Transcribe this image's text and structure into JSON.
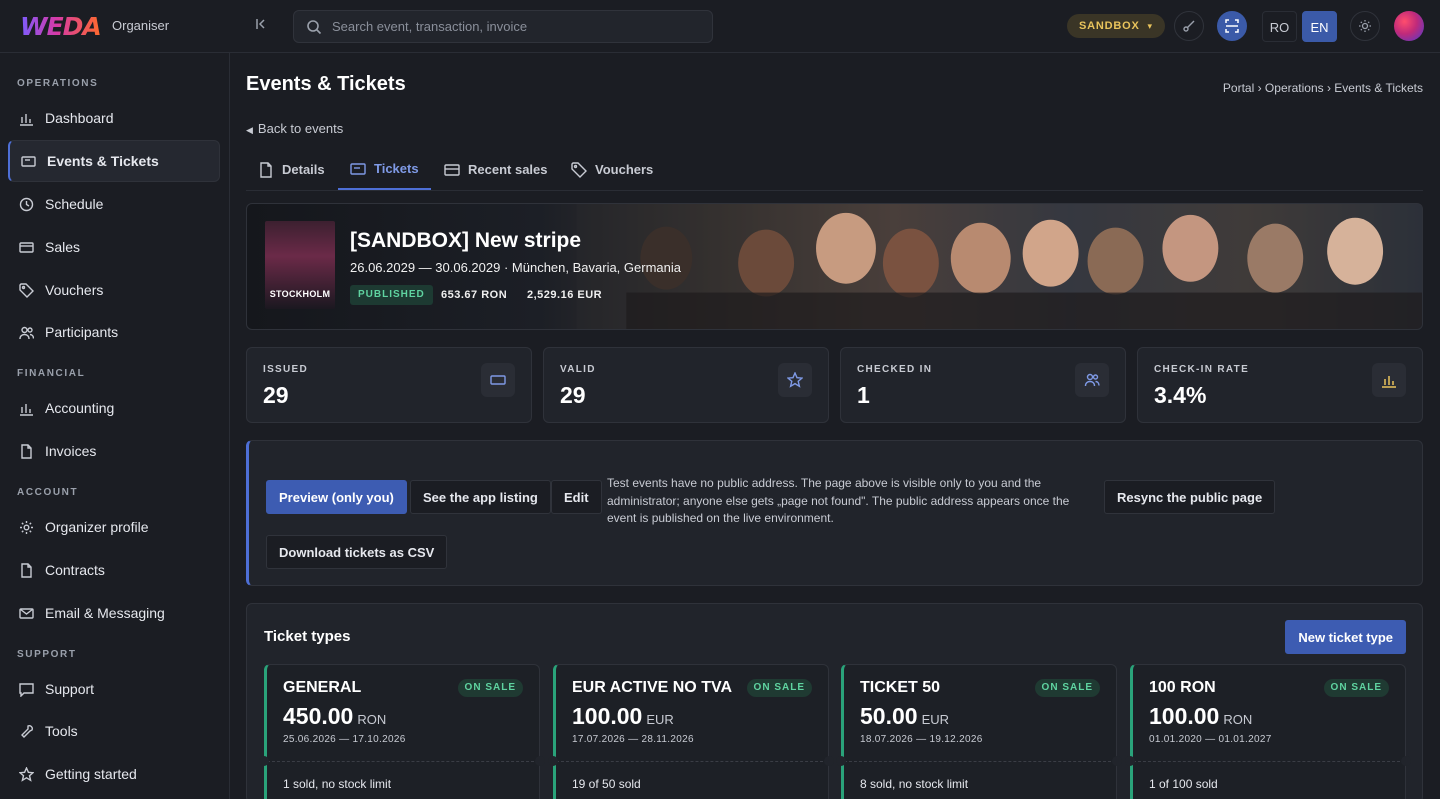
{
  "app": {
    "logo": "WEDA",
    "org_label": "Organiser"
  },
  "search": {
    "placeholder": "Search event, transaction, invoice"
  },
  "topbar": {
    "sandbox_label": "SANDBOX",
    "lang_ro": "RO",
    "lang_en": "EN",
    "active_lang": "EN"
  },
  "sidebar": {
    "sections": [
      {
        "title": "OPERATIONS",
        "items": [
          {
            "label": "Dashboard",
            "icon": "bar-chart-icon"
          },
          {
            "label": "Events & Tickets",
            "icon": "ticket-icon",
            "active": true
          },
          {
            "label": "Schedule",
            "icon": "clock-icon"
          },
          {
            "label": "Sales",
            "icon": "card-icon"
          },
          {
            "label": "Vouchers",
            "icon": "tag-icon"
          },
          {
            "label": "Participants",
            "icon": "users-icon"
          }
        ]
      },
      {
        "title": "FINANCIAL",
        "items": [
          {
            "label": "Accounting",
            "icon": "bar-chart-icon"
          },
          {
            "label": "Invoices",
            "icon": "document-icon"
          }
        ]
      },
      {
        "title": "ACCOUNT",
        "items": [
          {
            "label": "Organizer profile",
            "icon": "gear-icon"
          },
          {
            "label": "Contracts",
            "icon": "document-icon"
          },
          {
            "label": "Email & Messaging",
            "icon": "mail-icon"
          }
        ]
      },
      {
        "title": "SUPPORT",
        "items": [
          {
            "label": "Support",
            "icon": "chat-icon"
          },
          {
            "label": "Tools",
            "icon": "wrench-icon"
          },
          {
            "label": "Getting started",
            "icon": "star-icon"
          }
        ]
      }
    ]
  },
  "page": {
    "title": "Events & Tickets",
    "breadcrumb": "Portal › Operations › Events & Tickets",
    "back_link": "Back to events",
    "tabs": [
      {
        "label": "Details",
        "icon": "document-icon"
      },
      {
        "label": "Tickets",
        "icon": "ticket-icon",
        "active": true
      },
      {
        "label": "Recent sales",
        "icon": "card-icon"
      },
      {
        "label": "Vouchers",
        "icon": "tag-icon"
      }
    ]
  },
  "event": {
    "title": "[SANDBOX] New stripe",
    "subtitle": "26.06.2029 — 30.06.2029 · München, Bavaria, Germania",
    "status": "PUBLISHED",
    "revenue_ron": "653.67 RON",
    "revenue_eur": "2,529.16 EUR",
    "poster_text": "STOCKHOLM"
  },
  "stats": [
    {
      "label": "ISSUED",
      "value": "29",
      "icon": "ticket-icon"
    },
    {
      "label": "VALID",
      "value": "29",
      "icon": "star-icon"
    },
    {
      "label": "CHECKED IN",
      "value": "1",
      "icon": "users-icon"
    },
    {
      "label": "CHECK-IN RATE",
      "value": "3.4%",
      "icon": "bar-chart-icon"
    }
  ],
  "actions": {
    "preview": "Preview (only you)",
    "app_listing": "See the app listing",
    "edit": "Edit",
    "info": "Test events have no public address. The page above is visible only to you and the administrator; anyone else gets „page not found\". The public address appears once the event is published on the live environment.",
    "resync": "Resync the public page",
    "download_csv": "Download tickets as CSV"
  },
  "ticket_types": {
    "title": "Ticket types",
    "new_button": "New ticket type",
    "items": [
      {
        "name": "GENERAL",
        "status": "ON SALE",
        "price": "450.00",
        "currency": "RON",
        "dates": "25.06.2026 — 17.10.2026",
        "sold": "1 sold, no stock limit"
      },
      {
        "name": "EUR ACTIVE NO TVA",
        "status": "ON SALE",
        "price": "100.00",
        "currency": "EUR",
        "dates": "17.07.2026 — 28.11.2026",
        "sold": "19 of 50 sold"
      },
      {
        "name": "TICKET 50",
        "status": "ON SALE",
        "price": "50.00",
        "currency": "EUR",
        "dates": "18.07.2026 — 19.12.2026",
        "sold": "8 sold, no stock limit"
      },
      {
        "name": "100 RON",
        "status": "ON SALE",
        "price": "100.00",
        "currency": "RON",
        "dates": "01.01.2020 — 01.01.2027",
        "sold": "1 of 100 sold"
      }
    ]
  },
  "colors": {
    "accent": "#4e6fd6",
    "success": "#5fd3a0",
    "sandbox": "#e9c45c",
    "background": "#1b1d23"
  }
}
